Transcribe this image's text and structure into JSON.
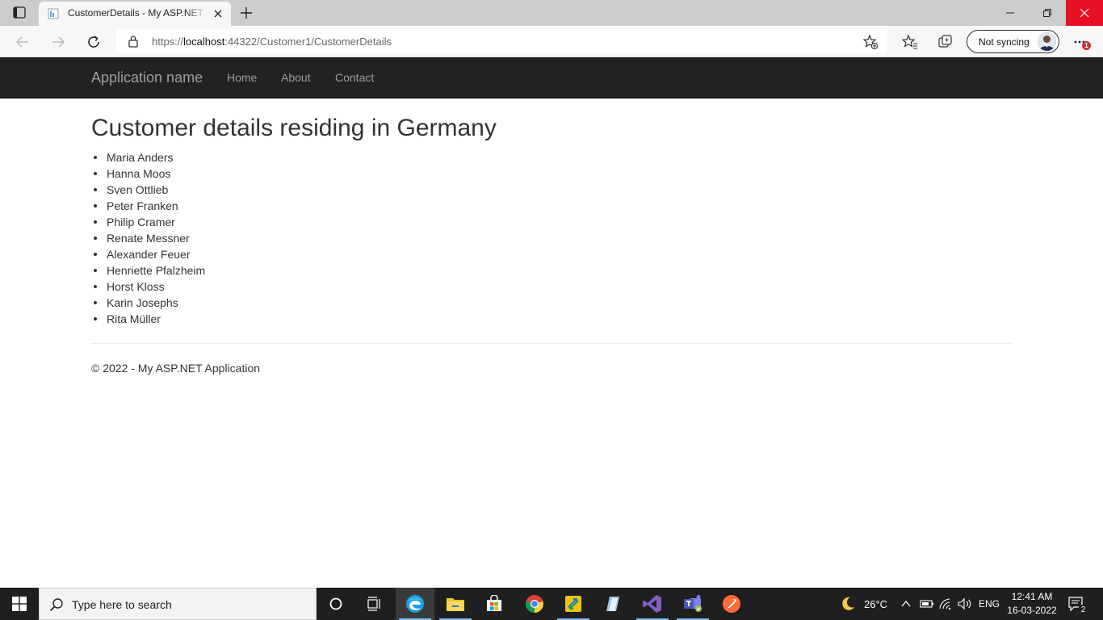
{
  "browser": {
    "tab_title": "CustomerDetails - My ASP.NET Application",
    "url_prefix": "https://",
    "url_host": "localhost",
    "url_path": ":44322/Customer1/CustomerDetails",
    "profile_label": "Not syncing",
    "notification_count": "1"
  },
  "navbar": {
    "brand": "Application name",
    "links": [
      "Home",
      "About",
      "Contact"
    ]
  },
  "main": {
    "heading": "Customer details residing in Germany",
    "customers": [
      "Maria Anders",
      "Hanna Moos",
      "Sven Ottlieb",
      "Peter Franken",
      "Philip Cramer",
      "Renate Messner",
      "Alexander Feuer",
      "Henriette Pfalzheim",
      "Horst Kloss",
      "Karin Josephs",
      "Rita Müller"
    ]
  },
  "footer": {
    "text": "© 2022 - My ASP.NET Application"
  },
  "taskbar": {
    "search_placeholder": "Type here to search",
    "weather": "26°C",
    "language": "ENG",
    "time": "12:41 AM",
    "date": "16-03-2022",
    "notification_count": "2"
  },
  "colors": {
    "navbar_bg": "#222222",
    "navbar_text": "#9d9d9d",
    "close_red": "#e81123",
    "taskbar_bg": "#1f1f1f"
  }
}
